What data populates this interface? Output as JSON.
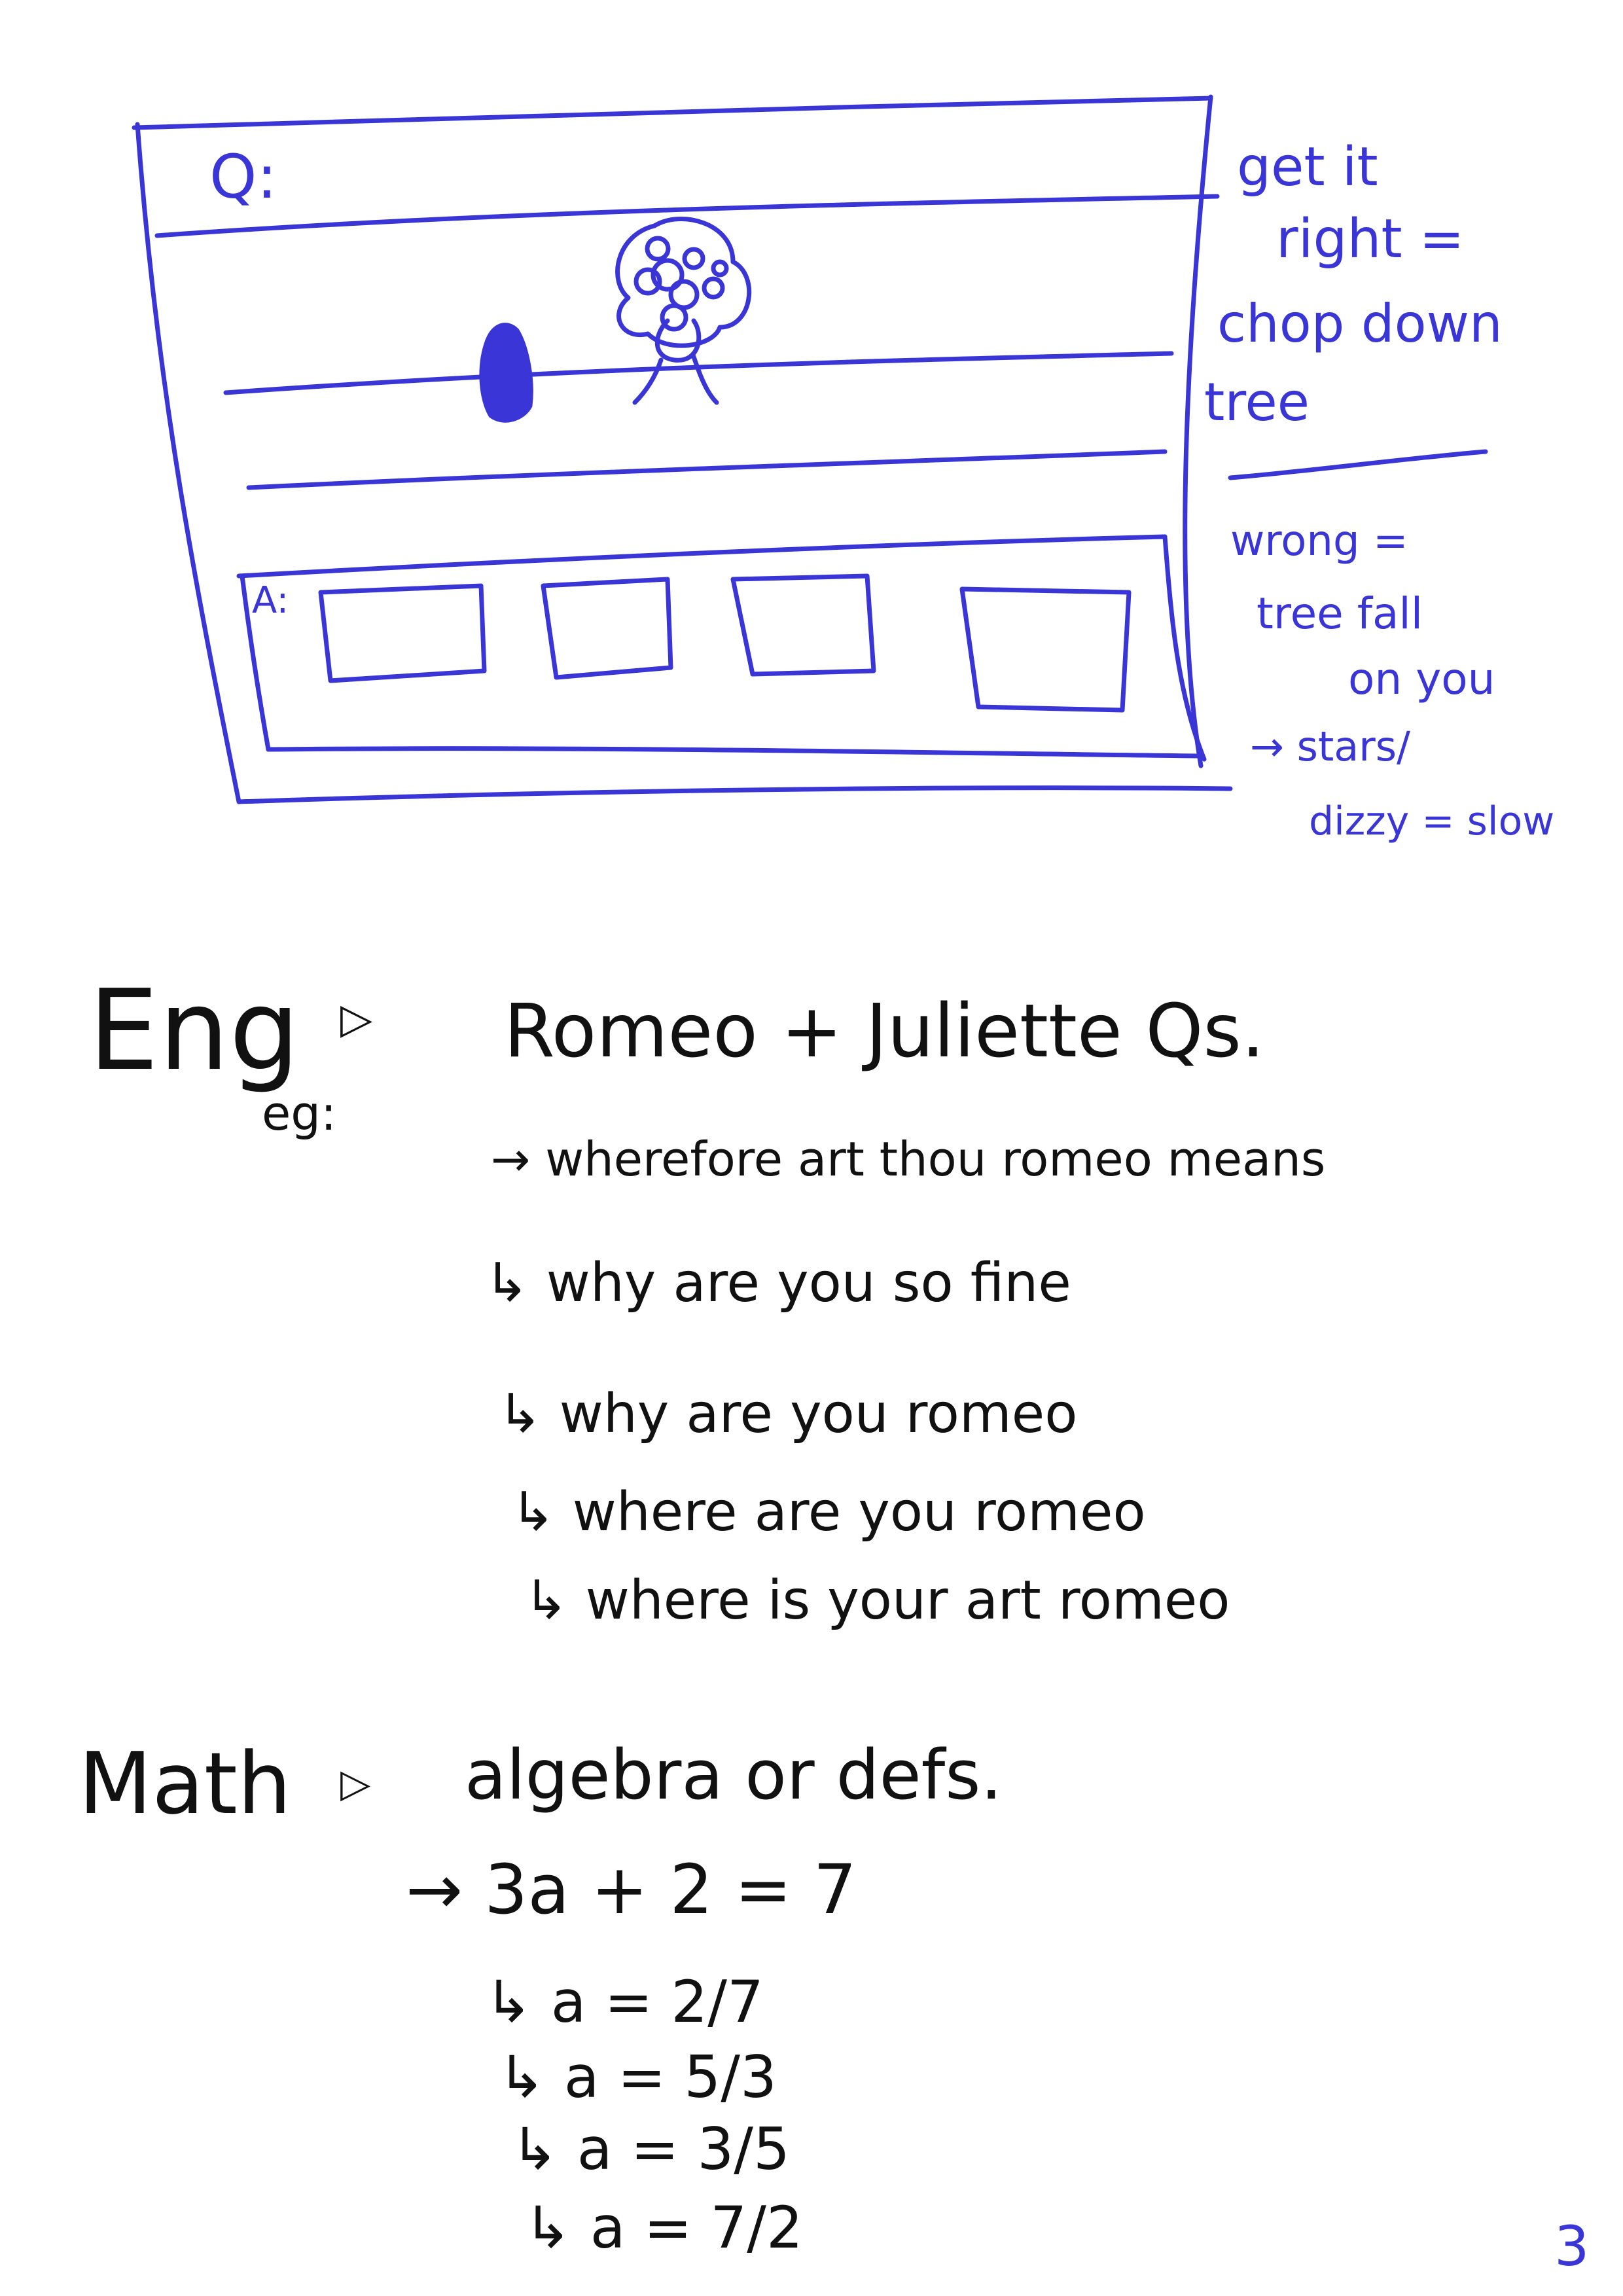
{
  "wireframe": {
    "question_label": "Q:",
    "answer_label": "A:"
  },
  "notes": {
    "right_lines": [
      "get it",
      "right =",
      "chop down",
      "tree"
    ],
    "wrong_lines": [
      "wrong =",
      "tree fall",
      "on you",
      "→ stars/",
      "dizzy = slow"
    ]
  },
  "english": {
    "heading": "Eng",
    "example_label": "eg:",
    "topic": "Romeo + Juliette Qs.",
    "question": "→ wherefore art thou romeo means",
    "answers": [
      "↳ why are you so fine",
      "↳ why are you romeo",
      "↳ where are you romeo",
      "↳ where is your art romeo"
    ]
  },
  "math": {
    "heading": "Math",
    "topic": "algebra or defs.",
    "question": "→ 3a + 2 = 7",
    "answers": [
      "↳ a = 2/7",
      "↳ a = 5/3",
      "↳ a = 3/5",
      "↳ a = 7/2"
    ]
  },
  "page_number": "3",
  "colors": {
    "sketch_ink": "#3a35d6",
    "text_ink": "#111111",
    "background": "#ffffff"
  }
}
